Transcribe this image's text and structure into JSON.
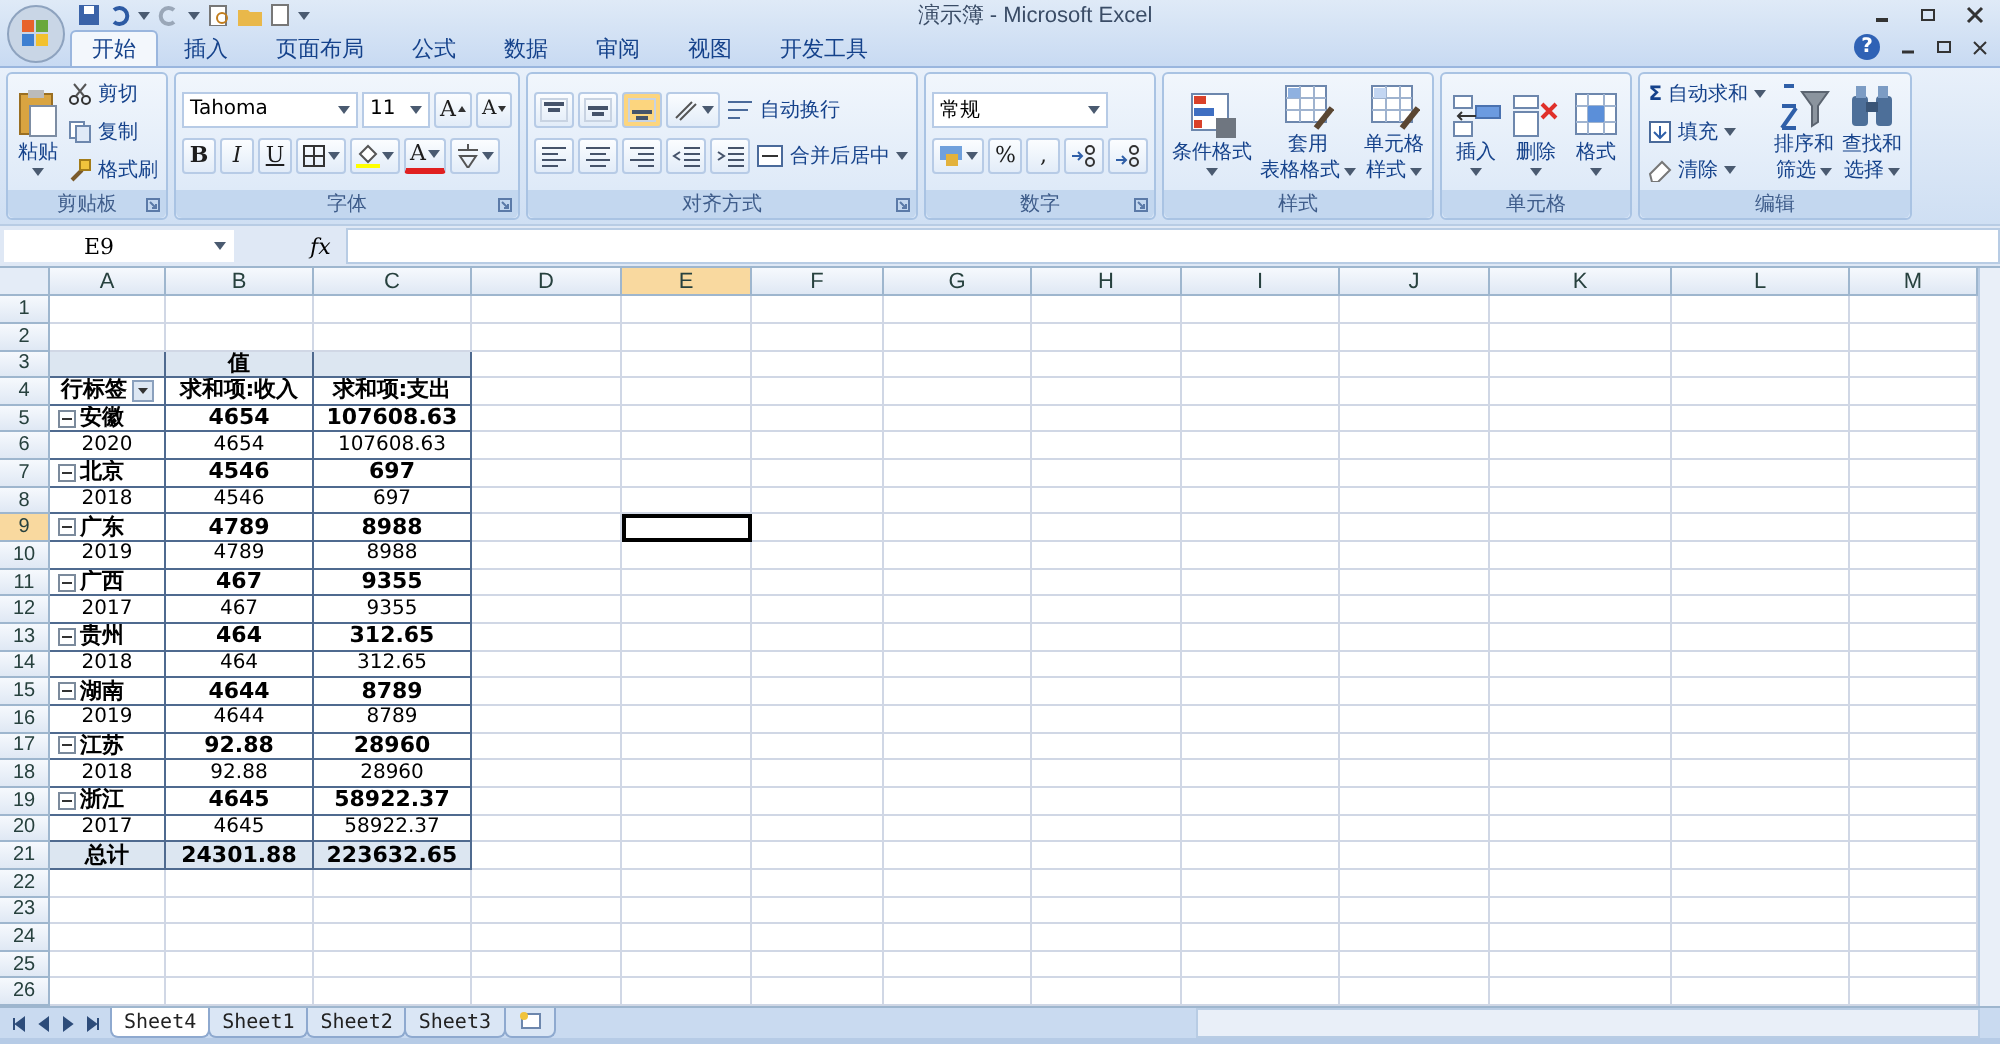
{
  "window": {
    "title": "演示簿 - Microsoft Excel"
  },
  "ribbon_tabs": [
    {
      "label": "开始",
      "selected": true
    },
    {
      "label": "插入",
      "selected": false
    },
    {
      "label": "页面布局",
      "selected": false
    },
    {
      "label": "公式",
      "selected": false
    },
    {
      "label": "数据",
      "selected": false
    },
    {
      "label": "审阅",
      "selected": false
    },
    {
      "label": "视图",
      "selected": false
    },
    {
      "label": "开发工具",
      "selected": false
    }
  ],
  "help": "?",
  "clipboard": {
    "label": "剪贴板",
    "paste": "粘贴",
    "cut": "剪切",
    "copy": "复制",
    "format_painter": "格式刷"
  },
  "font": {
    "label": "字体",
    "name": "Tahoma",
    "size": "11",
    "grow": "A",
    "shrink": "A",
    "bold": "B",
    "italic": "I",
    "underline": "U",
    "font_color_letter": "A"
  },
  "alignment": {
    "label": "对齐方式",
    "vertical": [
      {
        "selected": false
      },
      {
        "selected": false
      },
      {
        "selected": true
      }
    ],
    "wrap_text": "自动换行",
    "merge_center": "合并后居中"
  },
  "number": {
    "label": "数字",
    "format": "常规",
    "percent": "%",
    "comma": ","
  },
  "styles": {
    "label": "样式",
    "buttons": [
      {
        "lines": [
          "条件格式"
        ]
      },
      {
        "lines": [
          "套用",
          "表格格式"
        ]
      },
      {
        "lines": [
          "单元格",
          "样式"
        ]
      }
    ]
  },
  "cells": {
    "label": "单元格",
    "buttons": [
      {
        "label": "插入"
      },
      {
        "label": "删除"
      },
      {
        "label": "格式"
      }
    ]
  },
  "editing": {
    "label": "编辑",
    "sigma": "Σ",
    "autosum": "自动求和",
    "fill": "填充",
    "clear": "清除",
    "buttons": [
      {
        "lines": [
          "排序和",
          "筛选"
        ]
      },
      {
        "lines": [
          "查找和",
          "选择"
        ]
      }
    ]
  },
  "formula_bar": {
    "name_box": "E9",
    "function_label": "fx"
  },
  "sheet": {
    "columns": [
      {
        "label": "A",
        "selected": false
      },
      {
        "label": "B",
        "selected": false
      },
      {
        "label": "C",
        "selected": false
      },
      {
        "label": "D",
        "selected": false
      },
      {
        "label": "E",
        "selected": true
      },
      {
        "label": "F",
        "selected": false
      },
      {
        "label": "G",
        "selected": false
      },
      {
        "label": "H",
        "selected": false
      },
      {
        "label": "I",
        "selected": false
      },
      {
        "label": "J",
        "selected": false
      },
      {
        "label": "K",
        "selected": false
      },
      {
        "label": "L",
        "selected": false
      },
      {
        "label": "M",
        "selected": false
      }
    ],
    "rows": [
      {
        "label": "1",
        "selected": false
      },
      {
        "label": "2",
        "selected": false
      },
      {
        "label": "3",
        "selected": false
      },
      {
        "label": "4",
        "selected": false
      },
      {
        "label": "5",
        "selected": false
      },
      {
        "label": "6",
        "selected": false
      },
      {
        "label": "7",
        "selected": false
      },
      {
        "label": "8",
        "selected": false
      },
      {
        "label": "9",
        "selected": true
      },
      {
        "label": "10",
        "selected": false
      },
      {
        "label": "11",
        "selected": false
      },
      {
        "label": "12",
        "selected": false
      },
      {
        "label": "13",
        "selected": false
      },
      {
        "label": "14",
        "selected": false
      },
      {
        "label": "15",
        "selected": false
      },
      {
        "label": "16",
        "selected": false
      },
      {
        "label": "17",
        "selected": false
      },
      {
        "label": "18",
        "selected": false
      },
      {
        "label": "19",
        "selected": false
      },
      {
        "label": "20",
        "selected": false
      },
      {
        "label": "21",
        "selected": false
      },
      {
        "label": "22",
        "selected": false
      },
      {
        "label": "23",
        "selected": false
      },
      {
        "label": "24",
        "selected": false
      },
      {
        "label": "25",
        "selected": false
      },
      {
        "label": "26",
        "selected": false
      }
    ]
  },
  "pivot": {
    "value_header": "值",
    "columns": [
      "行标签",
      "求和项:收入",
      "求和项:支出"
    ],
    "groups": [
      {
        "label": "安徽",
        "expanded": true,
        "income": "4654",
        "expense": "107608.63",
        "children": [
          {
            "label": "2020",
            "income": "4654",
            "expense": "107608.63"
          }
        ]
      },
      {
        "label": "北京",
        "expanded": true,
        "income": "4546",
        "expense": "697",
        "children": [
          {
            "label": "2018",
            "income": "4546",
            "expense": "697"
          }
        ]
      },
      {
        "label": "广东",
        "expanded": true,
        "income": "4789",
        "expense": "8988",
        "children": [
          {
            "label": "2019",
            "income": "4789",
            "expense": "8988"
          }
        ]
      },
      {
        "label": "广西",
        "expanded": true,
        "income": "467",
        "expense": "9355",
        "children": [
          {
            "label": "2017",
            "income": "467",
            "expense": "9355"
          }
        ]
      },
      {
        "label": "贵州",
        "expanded": true,
        "income": "464",
        "expense": "312.65",
        "children": [
          {
            "label": "2018",
            "income": "464",
            "expense": "312.65"
          }
        ]
      },
      {
        "label": "湖南",
        "expanded": true,
        "income": "4644",
        "expense": "8789",
        "children": [
          {
            "label": "2019",
            "income": "4644",
            "expense": "8789"
          }
        ]
      },
      {
        "label": "江苏",
        "expanded": true,
        "income": "92.88",
        "expense": "28960",
        "children": [
          {
            "label": "2018",
            "income": "92.88",
            "expense": "28960"
          }
        ]
      },
      {
        "label": "浙江",
        "expanded": true,
        "income": "4645",
        "expense": "58922.37",
        "children": [
          {
            "label": "2017",
            "income": "4645",
            "expense": "58922.37"
          }
        ]
      }
    ],
    "total": {
      "label": "总计",
      "income": "24301.88",
      "expense": "223632.65"
    }
  },
  "sheet_tabs": [
    {
      "label": "Sheet4",
      "selected": true
    },
    {
      "label": "Sheet1",
      "selected": false
    },
    {
      "label": "Sheet2",
      "selected": false
    },
    {
      "label": "Sheet3",
      "selected": false
    }
  ]
}
